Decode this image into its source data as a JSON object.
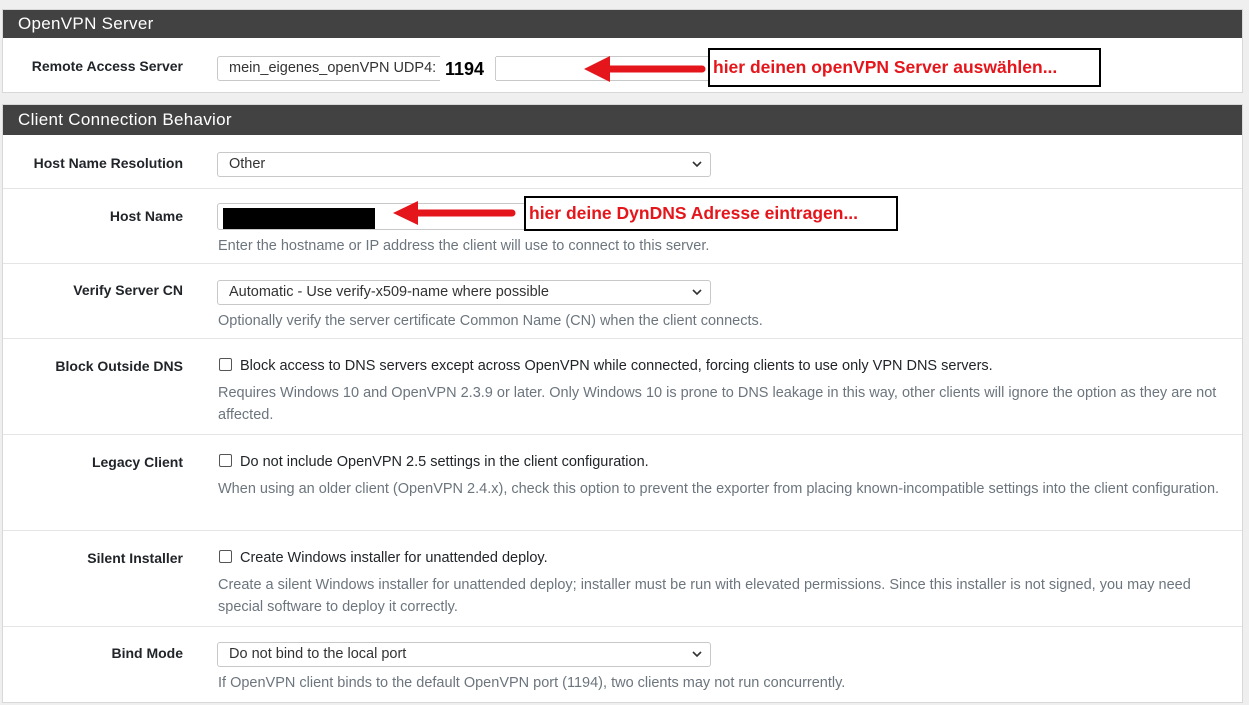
{
  "openvpn_server": {
    "heading": "OpenVPN Server",
    "remote_access": {
      "label": "Remote Access Server",
      "value": "mein_eigenes_openVPN UDP4:",
      "port": "1194"
    },
    "annotation": "hier deinen openVPN Server auswählen..."
  },
  "client_connection": {
    "heading": "Client Connection Behavior",
    "host_name_resolution": {
      "label": "Host Name Resolution",
      "value": "Other"
    },
    "host_name": {
      "label": "Host Name",
      "help": "Enter the hostname or IP address the client will use to connect to this server.",
      "annotation": "hier deine DynDNS Adresse eintragen..."
    },
    "verify_server_cn": {
      "label": "Verify Server CN",
      "value": "Automatic - Use verify-x509-name where possible",
      "help": "Optionally verify the server certificate Common Name (CN) when the client connects."
    },
    "block_outside_dns": {
      "label": "Block Outside DNS",
      "checked": false,
      "checkbox_text": "Block access to DNS servers except across OpenVPN while connected, forcing clients to use only VPN DNS servers.",
      "help": "Requires Windows 10 and OpenVPN 2.3.9 or later. Only Windows 10 is prone to DNS leakage in this way, other clients will ignore the option as they are not affected."
    },
    "legacy_client": {
      "label": "Legacy Client",
      "checked": false,
      "checkbox_text": "Do not include OpenVPN 2.5 settings in the client configuration.",
      "help": "When using an older client (OpenVPN 2.4.x), check this option to prevent the exporter from placing known-incompatible settings into the client configuration."
    },
    "silent_installer": {
      "label": "Silent Installer",
      "checked": false,
      "checkbox_text": "Create Windows installer for unattended deploy.",
      "help": "Create a silent Windows installer for unattended deploy; installer must be run with elevated permissions. Since this installer is not signed, you may need special software to deploy it correctly."
    },
    "bind_mode": {
      "label": "Bind Mode",
      "value": "Do not bind to the local port",
      "help": "If OpenVPN client binds to the default OpenVPN port (1194), two clients may not run concurrently."
    }
  },
  "colors": {
    "panel_heading_bg": "#424242",
    "annotation_red": "#e5161b",
    "help_text": "#6c757d"
  },
  "icons": [
    "chevron-down-icon",
    "arrow-left-icon",
    "checkbox-icon"
  ]
}
